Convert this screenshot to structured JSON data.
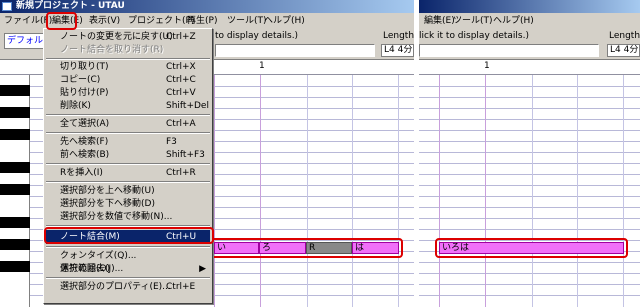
{
  "left": {
    "title": "新規プロジェクト - UTAU",
    "menu": [
      "ファイル(F)",
      "編集(E)",
      "表示(V)",
      "プロジェクト(P)",
      "再生(P)",
      "ツール(T)",
      "ヘルプ(H)"
    ],
    "toolbar": {
      "hint": "to display details.)",
      "length_label": "Length",
      "length_value": "L4  4分",
      "singer_button": "デフォルト"
    },
    "ruler_measure": "1",
    "notes": [
      "い",
      "ろ",
      "R",
      "は"
    ],
    "edit_menu": [
      {
        "label": "ノートの変更を元に戻す(U)",
        "shortcut": "Ctrl+Z",
        "disabled": false
      },
      {
        "label": "ノート結合を取り消す(R)",
        "shortcut": "",
        "disabled": true
      },
      {
        "label": "切り取り(T)",
        "shortcut": "Ctrl+X",
        "disabled": false
      },
      {
        "label": "コピー(C)",
        "shortcut": "Ctrl+C",
        "disabled": false
      },
      {
        "label": "貼り付け(P)",
        "shortcut": "Ctrl+V",
        "disabled": false
      },
      {
        "label": "削除(K)",
        "shortcut": "Shift+Del",
        "disabled": false
      },
      {
        "label": "全て選択(A)",
        "shortcut": "Ctrl+A",
        "disabled": false
      },
      {
        "label": "先へ検索(F)",
        "shortcut": "F3",
        "disabled": false
      },
      {
        "label": "前へ検索(B)",
        "shortcut": "Shift+F3",
        "disabled": false
      },
      {
        "label": "Rを挿入(I)",
        "shortcut": "Ctrl+R",
        "disabled": false
      },
      {
        "label": "選択部分を上へ移動(U)",
        "shortcut": "",
        "disabled": false
      },
      {
        "label": "選択部分を下へ移動(D)",
        "shortcut": "",
        "disabled": false
      },
      {
        "label": "選択部分を数値で移動(N)...",
        "shortcut": "",
        "disabled": false
      },
      {
        "label": "ノート結合(M)",
        "shortcut": "Ctrl+U",
        "disabled": false,
        "highlighted": true
      },
      {
        "label": "クォンタイズ(Q)...",
        "shortcut": "",
        "disabled": false
      },
      {
        "label": "休符の除去(J)...",
        "shortcut": "",
        "disabled": false
      },
      {
        "label": "選択範囲(O)",
        "shortcut": "",
        "disabled": false,
        "submenu": true
      },
      {
        "label": "選択部分のプロパティ(E)...",
        "shortcut": "Ctrl+E",
        "disabled": false
      }
    ],
    "submenu_arrow": "▶"
  },
  "right": {
    "menu": [
      "編集(E)",
      "ツール(T)",
      "ヘルプ(H)"
    ],
    "toolbar": {
      "hint": "lick it to display details.)",
      "length_label": "Length",
      "length_value": "L4  4分"
    },
    "ruler_measure": "1",
    "merged_note": "いろは"
  },
  "colors": {
    "note_fill": "#f070f8",
    "rest_fill": "#888888",
    "highlight": "#0a246a",
    "annotation": "#dc0000"
  }
}
